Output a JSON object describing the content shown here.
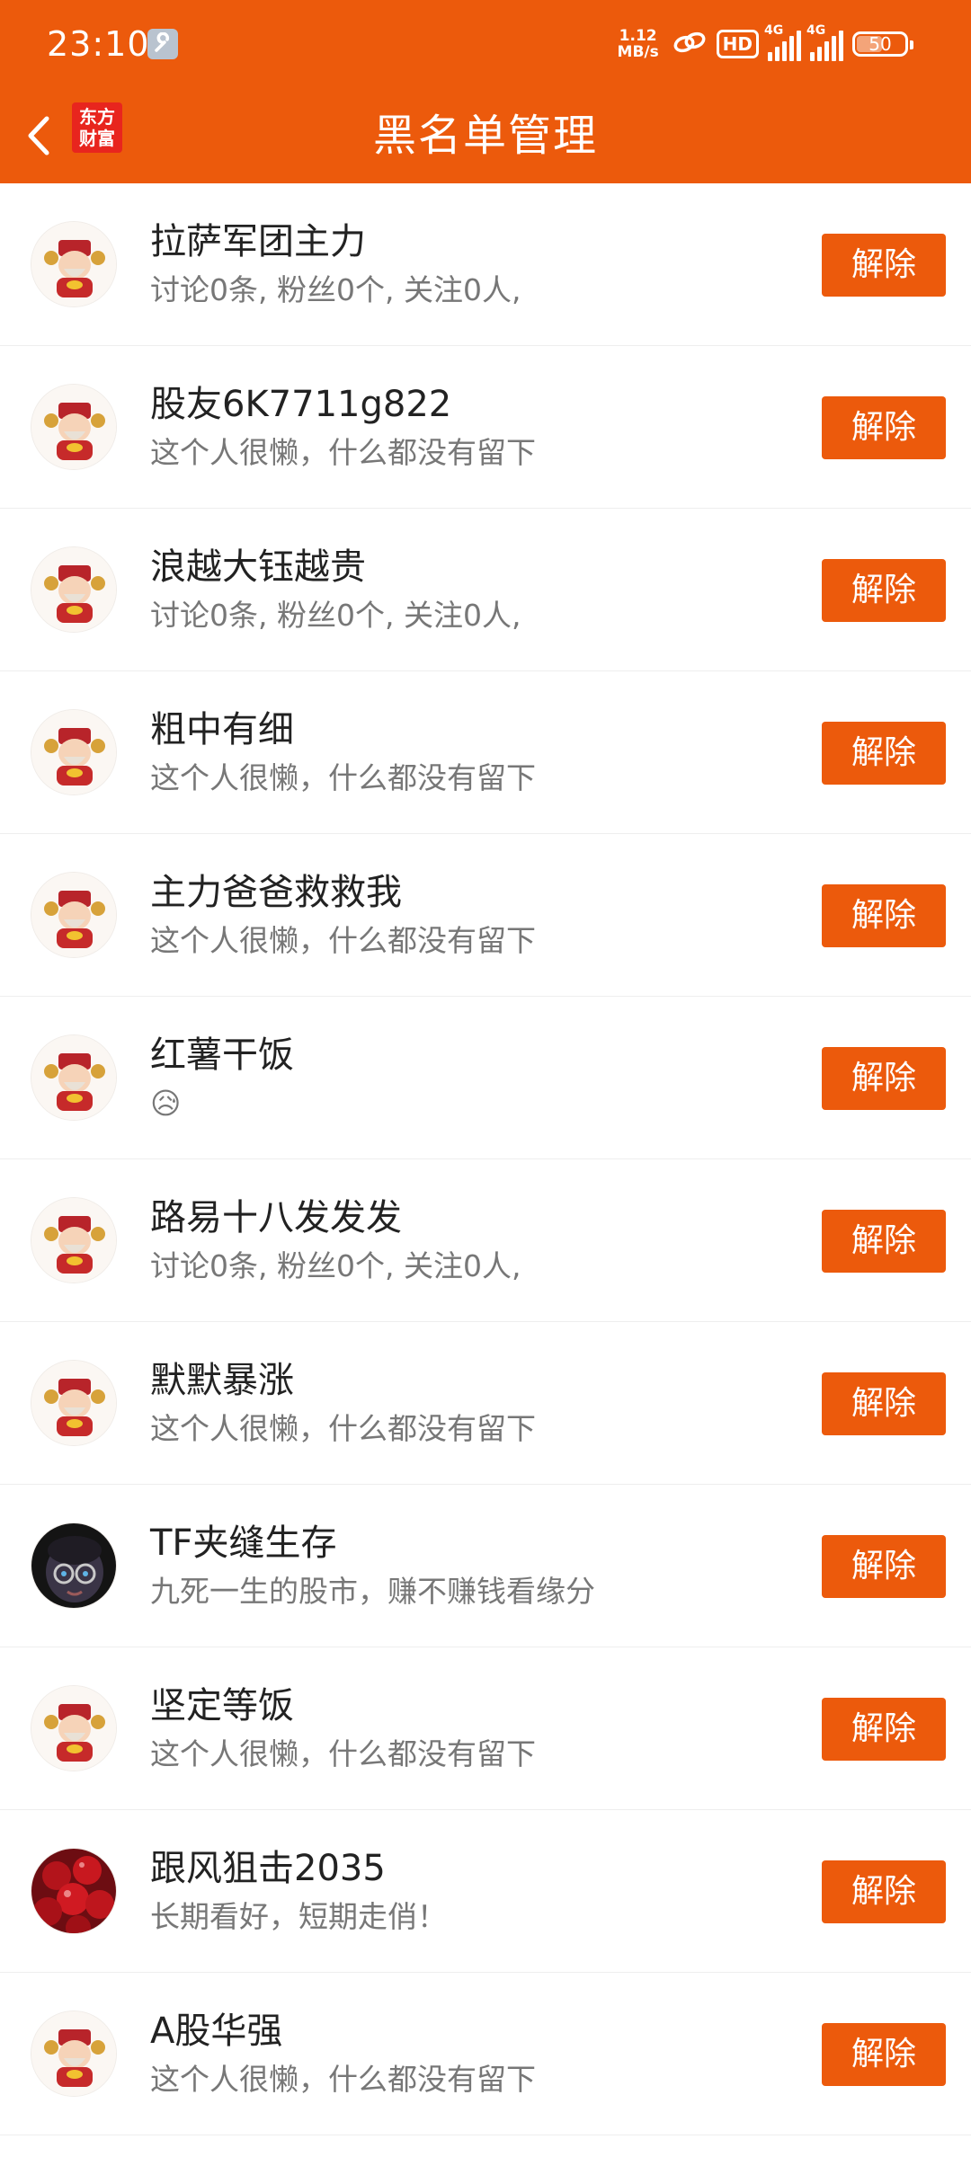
{
  "status_bar": {
    "time": "23:10",
    "net_speed_value": "1.12",
    "net_speed_unit": "MB/s",
    "hd_label": "HD",
    "signal1_label": "4G",
    "signal2_label": "4G",
    "battery_level": "50"
  },
  "header": {
    "title": "黑名单管理",
    "logo_line1": "东方",
    "logo_line2": "财富"
  },
  "colors": {
    "accent": "#ec5a0c",
    "logo_red": "#e8251e"
  },
  "blacklist": {
    "unblock_label": "解除",
    "items": [
      {
        "name": "拉萨军团主力",
        "desc": "讨论0条, 粉丝0个, 关注0人,",
        "avatar": "fortune-god-icon"
      },
      {
        "name": "股友6K7711g822",
        "desc": "这个人很懒，什么都没有留下",
        "avatar": "fortune-god-icon"
      },
      {
        "name": "浪越大钰越贵",
        "desc": "讨论0条, 粉丝0个, 关注0人,",
        "avatar": "fortune-god-icon"
      },
      {
        "name": "粗中有细",
        "desc": "这个人很懒，什么都没有留下",
        "avatar": "fortune-god-icon"
      },
      {
        "name": "主力爸爸救救我",
        "desc": "这个人很懒，什么都没有留下",
        "avatar": "fortune-god-icon"
      },
      {
        "name": "红薯干饭",
        "desc": "😥",
        "avatar": "fortune-god-icon"
      },
      {
        "name": "路易十八发发发",
        "desc": "讨论0条, 粉丝0个, 关注0人,",
        "avatar": "fortune-god-icon"
      },
      {
        "name": "默默暴涨",
        "desc": "这个人很懒，什么都没有留下",
        "avatar": "fortune-god-icon"
      },
      {
        "name": "TF夹缝生存",
        "desc": "九死一生的股市，赚不赚钱看缘分",
        "avatar": "cartoon-face-icon"
      },
      {
        "name": "坚定等饭",
        "desc": "这个人很懒，什么都没有留下",
        "avatar": "fortune-god-icon"
      },
      {
        "name": "跟风狙击2035",
        "desc": "长期看好，短期走俏！",
        "avatar": "cherries-icon"
      },
      {
        "name": "A股华强",
        "desc": "这个人很懒，什么都没有留下",
        "avatar": "fortune-god-icon"
      }
    ]
  }
}
